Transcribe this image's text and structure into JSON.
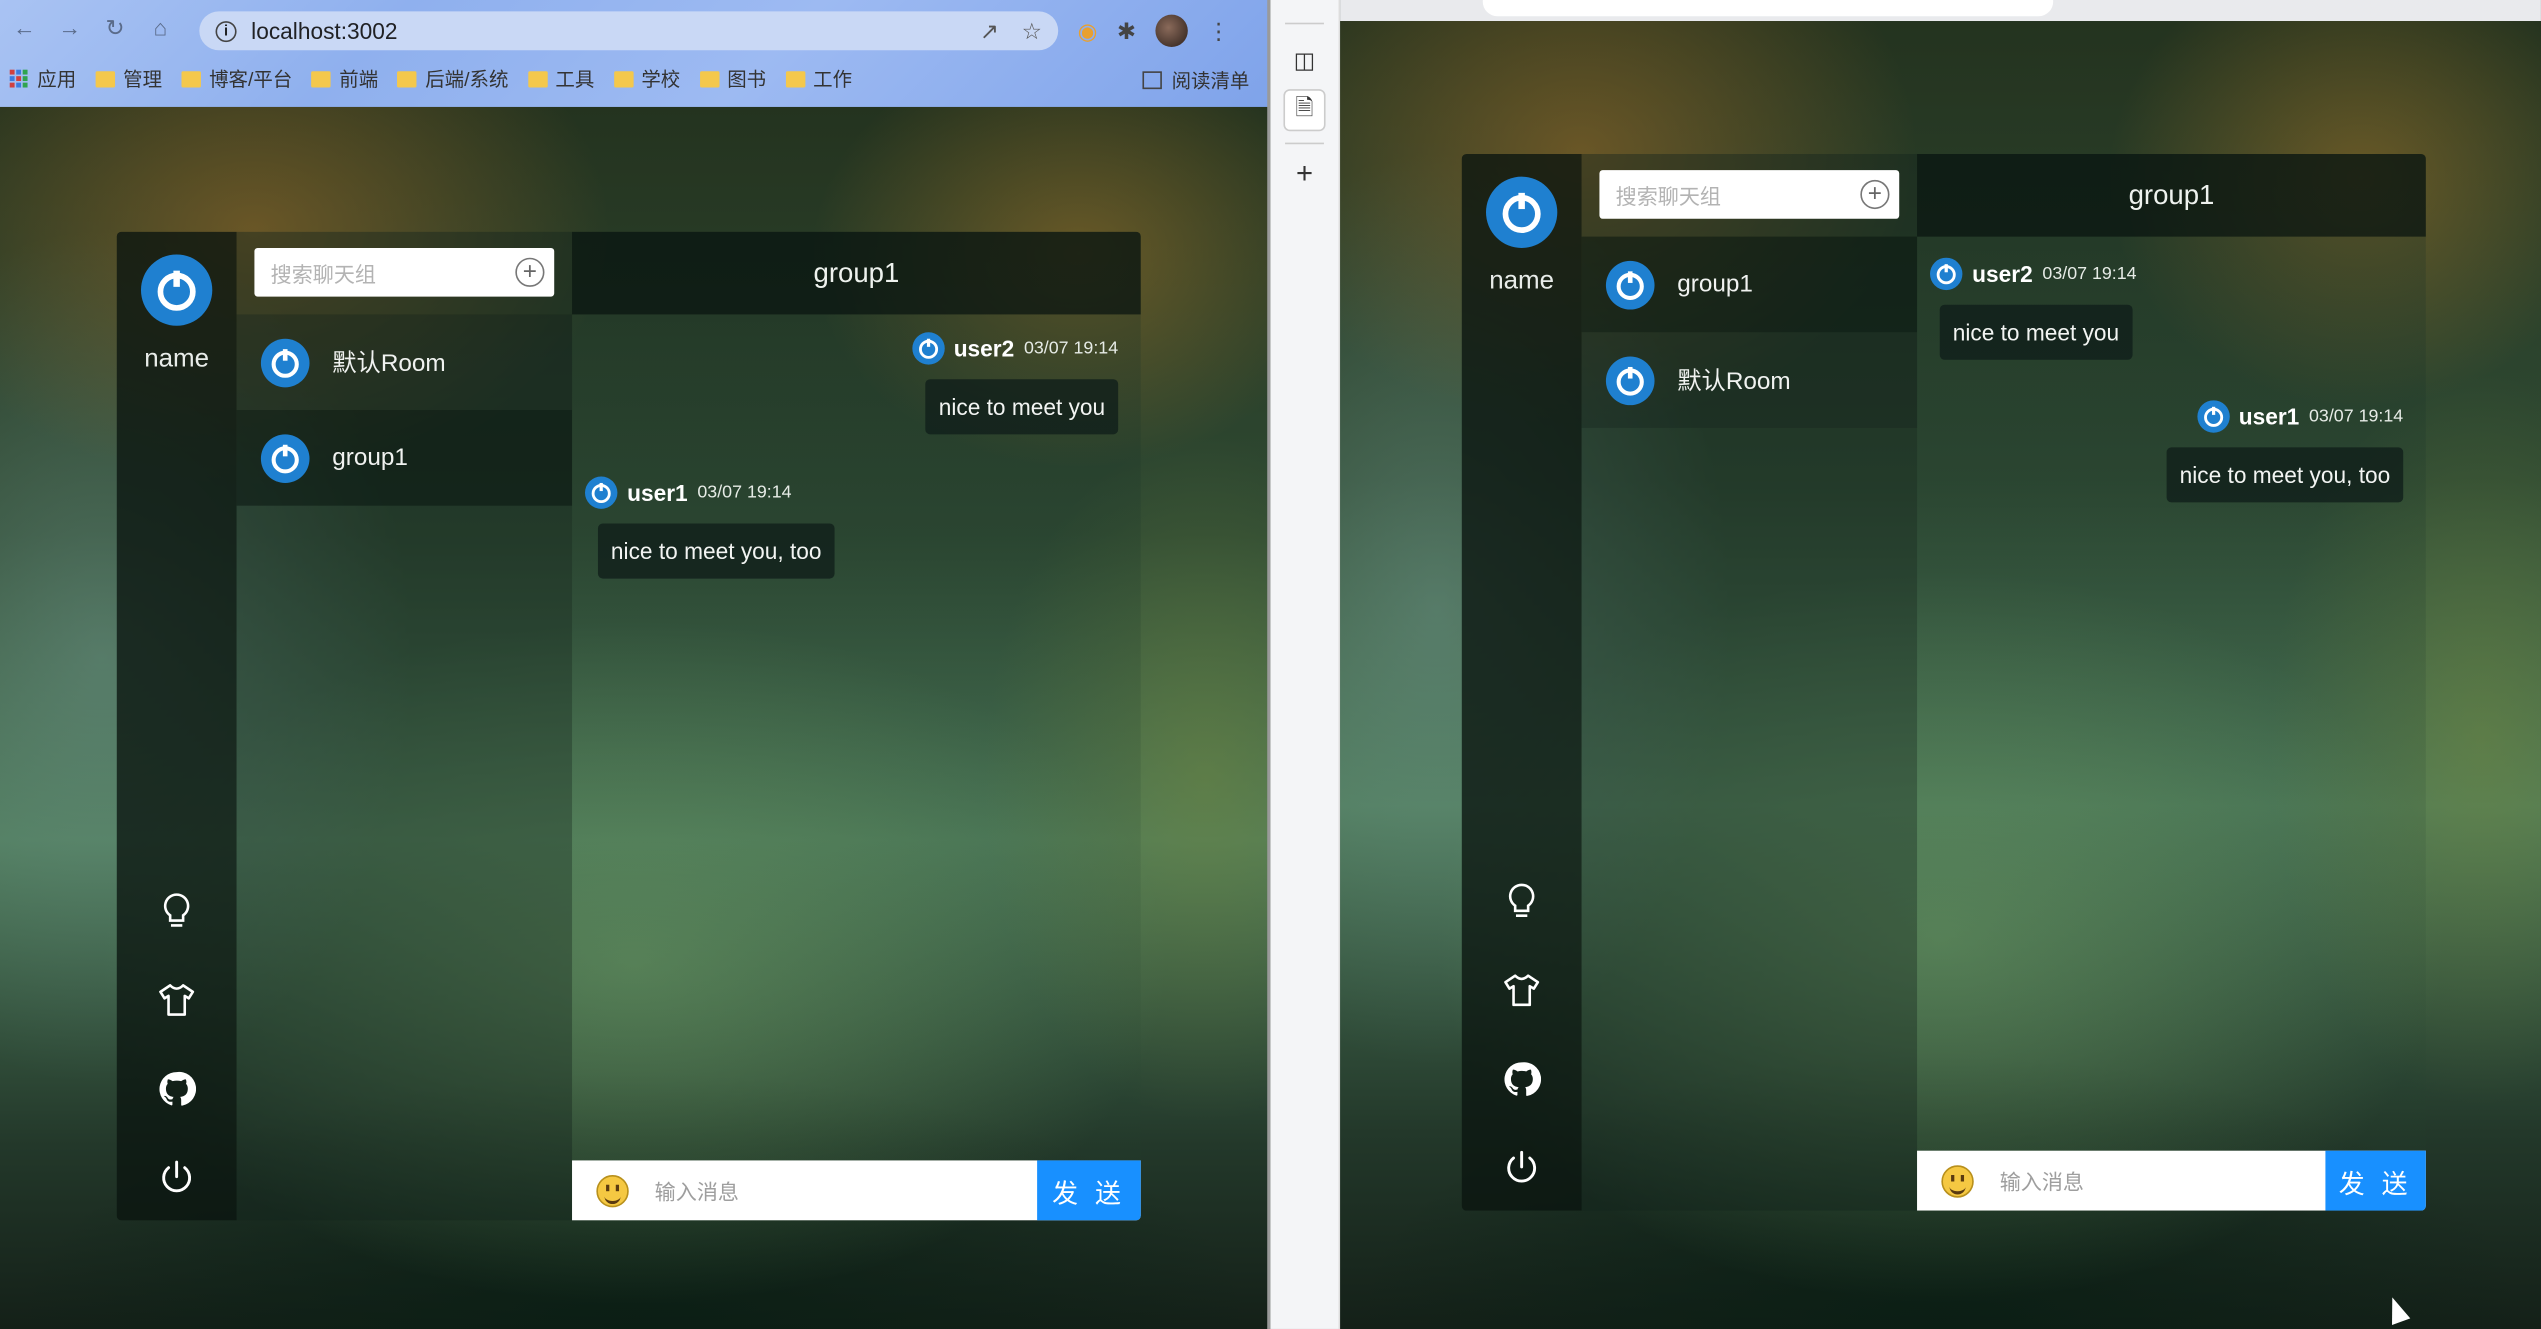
{
  "left_browser": {
    "url": "localhost:3002",
    "bookmarks": [
      "应用",
      "管理",
      "博客/平台",
      "前端",
      "后端/系统",
      "工具",
      "学校",
      "图书",
      "工作"
    ],
    "reading_list": "阅读清单"
  },
  "left_app": {
    "user_name": "name",
    "search_placeholder": "搜索聊天组",
    "groups": [
      "默认Room",
      "group1"
    ],
    "selected_group": "group1",
    "header_title": "group1",
    "messages": [
      {
        "user": "user2",
        "time": "03/07 19:14",
        "text": "nice to meet you",
        "side": "right"
      },
      {
        "user": "user1",
        "time": "03/07 19:14",
        "text": "nice to meet you, too",
        "side": "left"
      }
    ],
    "input_placeholder": "输入消息",
    "send_label": "发 送"
  },
  "right_app": {
    "user_name": "name",
    "search_placeholder": "搜索聊天组",
    "groups": [
      "group1",
      "默认Room"
    ],
    "selected_group": "group1",
    "header_title": "group1",
    "messages": [
      {
        "user": "user2",
        "time": "03/07 19:14",
        "text": "nice to meet you",
        "side": "left"
      },
      {
        "user": "user1",
        "time": "03/07 19:14",
        "text": "nice to meet you, too",
        "side": "right"
      }
    ],
    "input_placeholder": "输入消息",
    "send_label": "发 送"
  },
  "rail_icons": [
    "lightbulb-icon",
    "tshirt-icon",
    "github-icon",
    "power-icon"
  ],
  "colors": {
    "accent": "#1890ff",
    "avatar": "#1f80d0"
  }
}
